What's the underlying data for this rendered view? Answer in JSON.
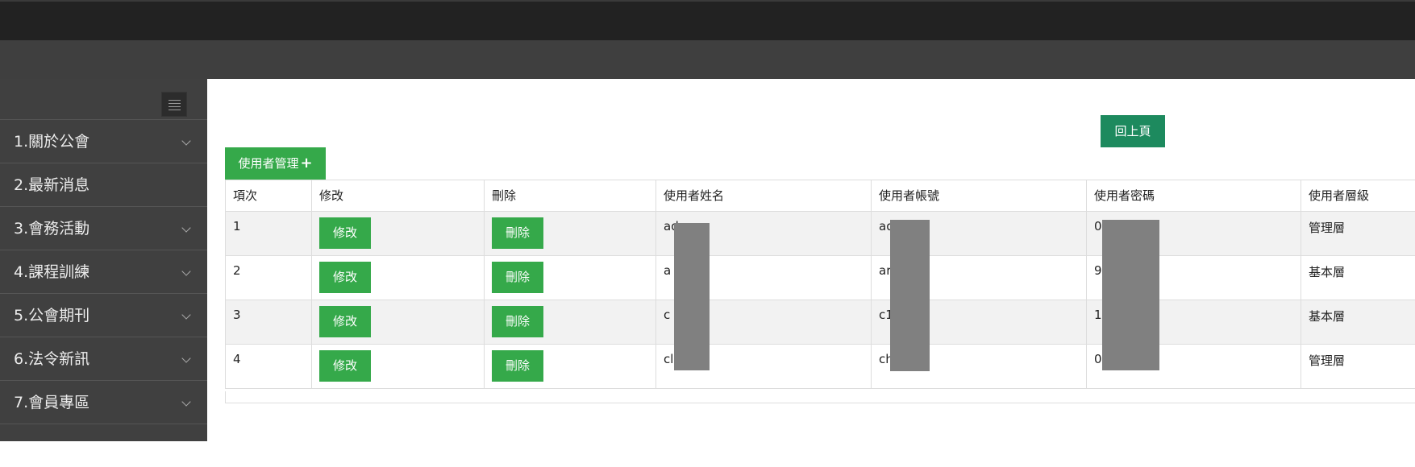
{
  "sidebar": {
    "items": [
      {
        "label": "1.關於公會",
        "chevron": true
      },
      {
        "label": "2.最新消息",
        "chevron": false
      },
      {
        "label": "3.會務活動",
        "chevron": true
      },
      {
        "label": "4.課程訓練",
        "chevron": true
      },
      {
        "label": "5.公會期刊",
        "chevron": true
      },
      {
        "label": "6.法令新訊",
        "chevron": true
      },
      {
        "label": "7.會員專區",
        "chevron": true
      }
    ]
  },
  "main": {
    "back_label": "回上頁",
    "section_label": "使用者管理",
    "add_icon": "plus-icon",
    "table": {
      "headers": [
        "項次",
        "修改",
        "刪除",
        "使用者姓名",
        "使用者帳號",
        "使用者密碼",
        "使用者層級"
      ],
      "edit_label": "修改",
      "delete_label": "刪除",
      "rows": [
        {
          "index": "1",
          "name": "ad",
          "account": "ad",
          "password": "0",
          "level": "管理層"
        },
        {
          "index": "2",
          "name": "a",
          "account": "ar",
          "password": "9",
          "level": "基本層"
        },
        {
          "index": "3",
          "name": "c",
          "account": "c1",
          "password": "1",
          "level": "基本層"
        },
        {
          "index": "4",
          "name": "cl",
          "account": "ch",
          "password": "0",
          "level": "管理層"
        }
      ]
    }
  },
  "colors": {
    "topbar": "#222222",
    "subbar": "#3f3f3f",
    "sidebar": "#404040",
    "green_button": "#35a94a",
    "back_button": "#1d8a5e"
  }
}
